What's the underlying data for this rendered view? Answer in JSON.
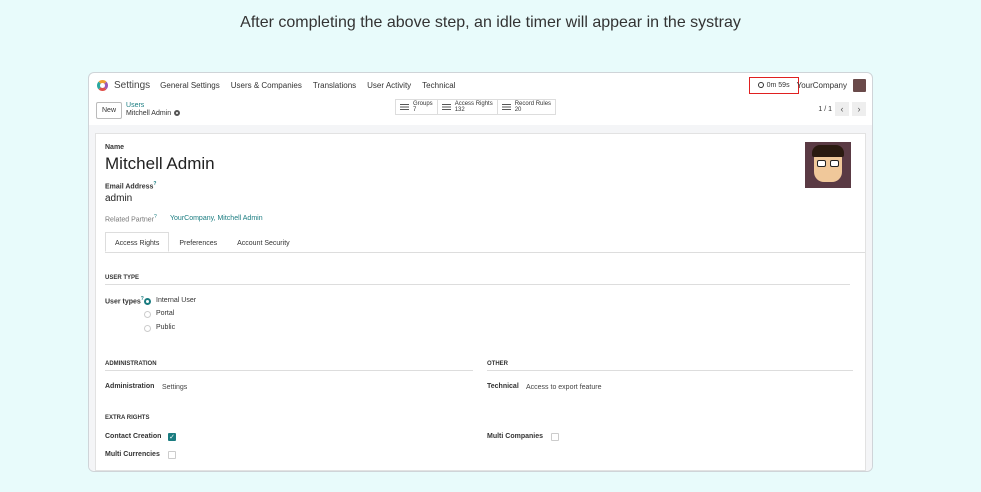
{
  "caption": "After completing the above step, an idle timer will appear in the systray",
  "nav": {
    "brand": "Settings",
    "menu": [
      "General Settings",
      "Users & Companies",
      "Translations",
      "User Activity",
      "Technical"
    ],
    "timer": "0m 59s",
    "company": "YourCompany"
  },
  "controlbar": {
    "new_label": "New",
    "breadcrumb_parent": "Users",
    "breadcrumb_current": "Mitchell Admin",
    "stats": [
      {
        "label": "Groups",
        "count": "7"
      },
      {
        "label": "Access Rights",
        "count": "132"
      },
      {
        "label": "Record Rules",
        "count": "20"
      }
    ],
    "pager": "1 / 1"
  },
  "form": {
    "name_label": "Name",
    "name_value": "Mitchell Admin",
    "email_label": "Email Address",
    "email_value": "admin",
    "partner_label": "Related Partner",
    "partner_value": "YourCompany, Mitchell Admin",
    "tabs": [
      "Access Rights",
      "Preferences",
      "Account Security"
    ],
    "user_type_section": "USER TYPE",
    "user_types_label": "User types",
    "user_types": [
      "Internal User",
      "Portal",
      "Public"
    ],
    "admin_section": "ADMINISTRATION",
    "admin_label": "Administration",
    "admin_value": "Settings",
    "other_section": "OTHER",
    "technical_label": "Technical",
    "technical_value": "Access to export feature",
    "extra_section": "EXTRA RIGHTS",
    "contact_creation": "Contact Creation",
    "multi_companies": "Multi Companies",
    "multi_currencies": "Multi Currencies",
    "tooltip_mark": "?"
  },
  "colors": {
    "accent": "#1a7c80",
    "timer_border": "#e02020",
    "background": "#e8fbfb"
  }
}
